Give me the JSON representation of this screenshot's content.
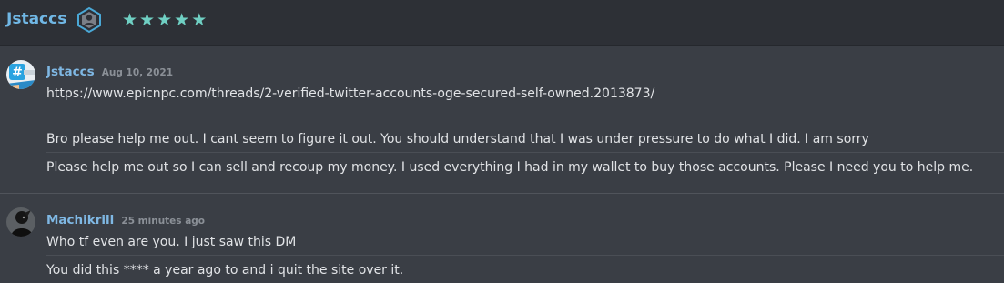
{
  "header": {
    "username": "Jstaccs",
    "badge_icon": "user-shield-icon",
    "rating": 5,
    "star_color": "#6fcfc3",
    "username_color": "#70b7e5"
  },
  "messages": [
    {
      "author": "Jstaccs",
      "timestamp": "Aug 10, 2021",
      "avatar_icon": "hashtag-avatar",
      "lines": [
        "https://www.epicnpc.com/threads/2-verified-twitter-accounts-oge-secured-self-owned.2013873/",
        "",
        "Bro please help me out. I cant seem to figure it out. You should understand that I was under pressure to do what I did. I am sorry",
        "Please help me out so I can sell and recoup my money. I used everything I had in my wallet to buy those accounts. Please I need you to help me."
      ]
    },
    {
      "author": "Machikrill",
      "timestamp": "25 minutes ago",
      "avatar_icon": "dark-figure-avatar",
      "lines": [
        "Who tf even are you. I just saw this DM",
        "You did this **** a year ago to and i quit the site over it."
      ]
    }
  ]
}
